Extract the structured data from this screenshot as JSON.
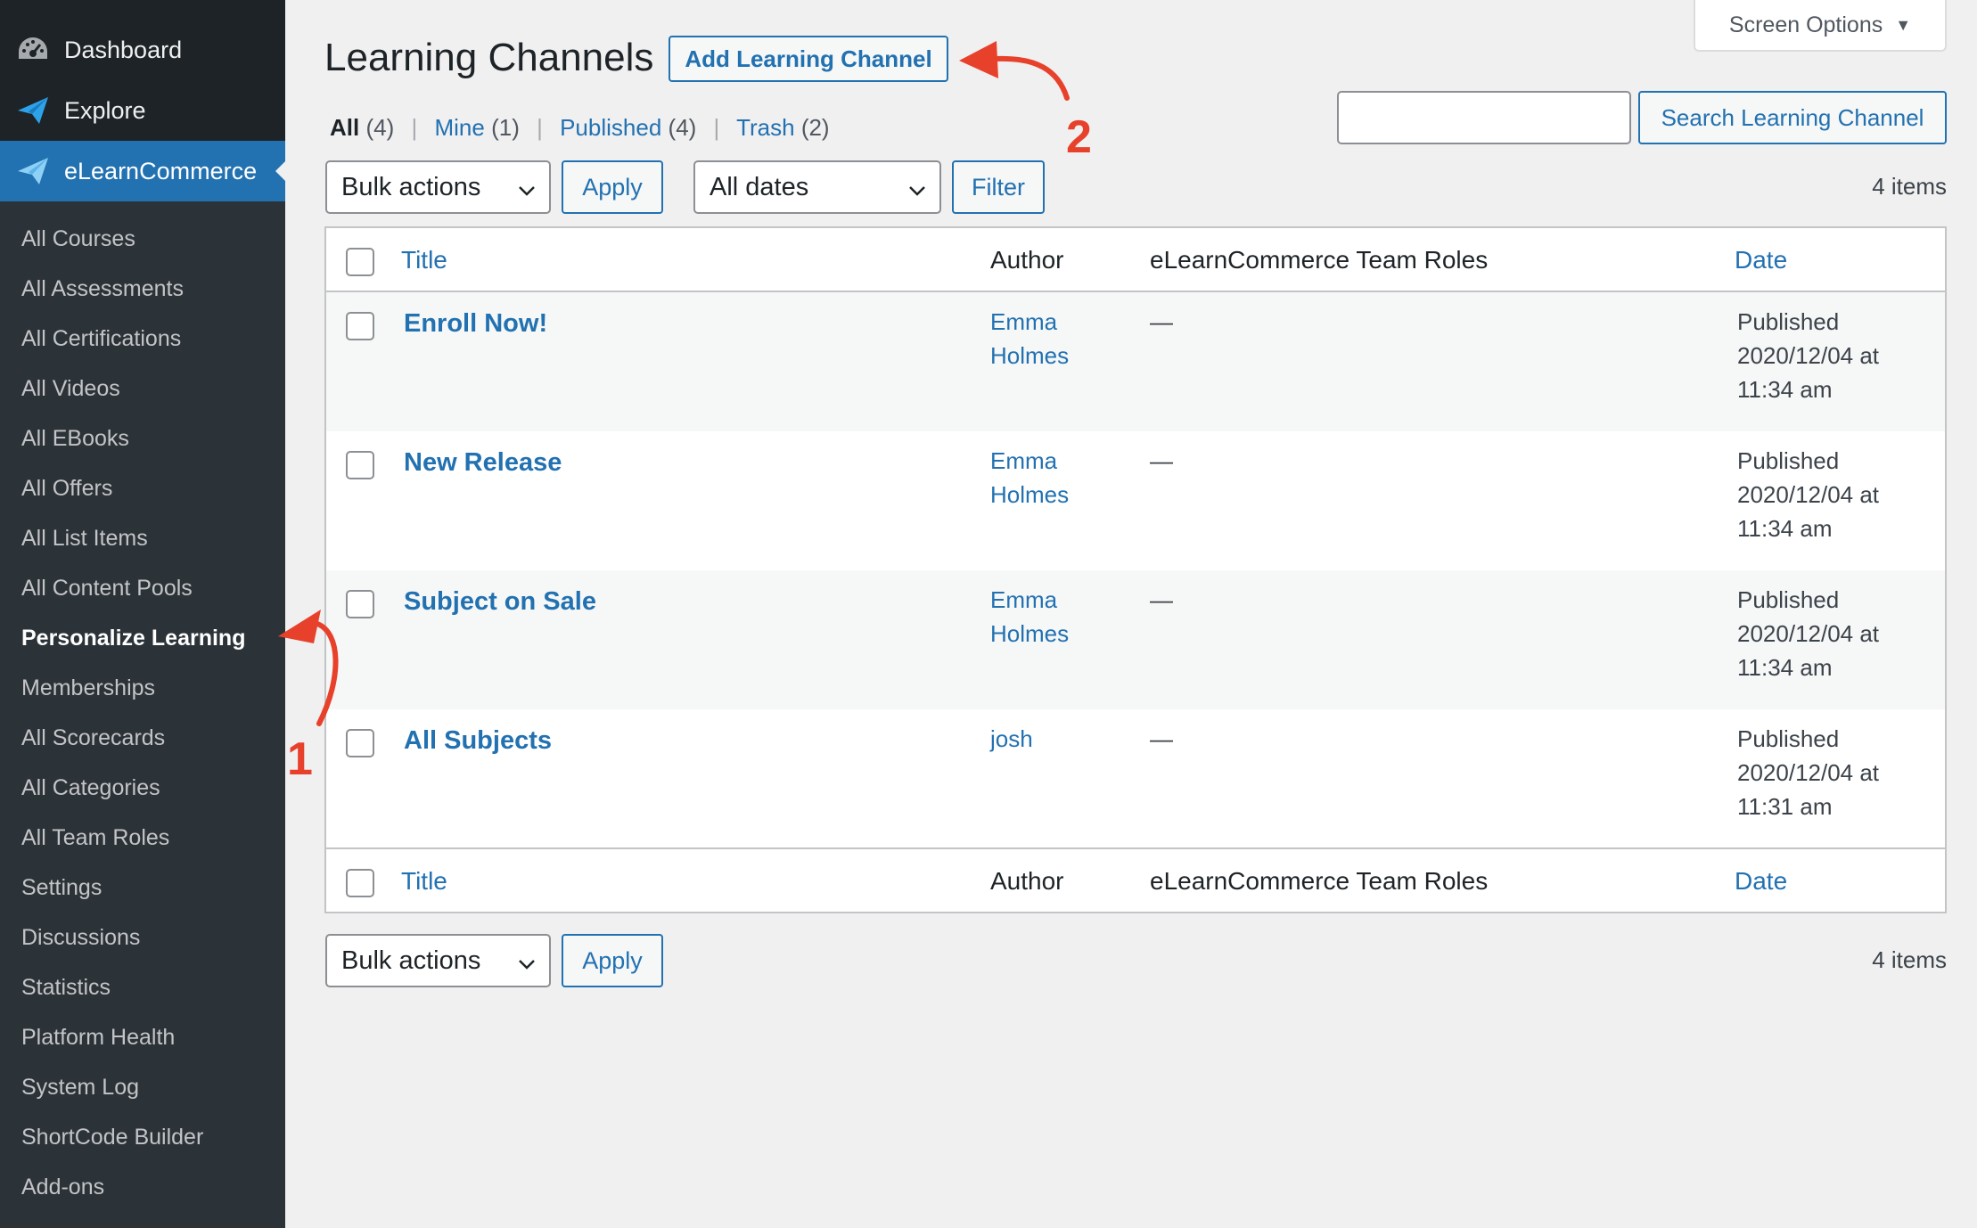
{
  "sidebar": {
    "top_items": [
      {
        "label": "Dashboard",
        "icon": "dashboard-icon"
      },
      {
        "label": "Explore",
        "icon": "paper-plane-icon"
      },
      {
        "label": "eLearnCommerce",
        "icon": "paper-plane-icon",
        "current": true
      }
    ],
    "submenu": [
      "All Courses",
      "All Assessments",
      "All Certifications",
      "All Videos",
      "All EBooks",
      "All Offers",
      "All List Items",
      "All Content Pools",
      "Personalize Learning",
      "Memberships",
      "All Scorecards",
      "All Categories",
      "All Team Roles",
      "Settings",
      "Discussions",
      "Statistics",
      "Platform Health",
      "System Log",
      "ShortCode Builder",
      "Add-ons"
    ],
    "active_submenu": "Personalize Learning"
  },
  "header": {
    "title": "Learning Channels",
    "add_button": "Add Learning Channel",
    "screen_options": "Screen Options"
  },
  "filters": {
    "views": [
      {
        "label": "All",
        "count": "(4)",
        "current": true
      },
      {
        "label": "Mine",
        "count": "(1)"
      },
      {
        "label": "Published",
        "count": "(4)"
      },
      {
        "label": "Trash",
        "count": "(2)"
      }
    ],
    "separator": "|",
    "search_button": "Search Learning Channel",
    "search_value": "",
    "bulk_actions": "Bulk actions",
    "apply": "Apply",
    "dates": "All dates",
    "filter": "Filter",
    "items_count": "4 items"
  },
  "table": {
    "columns": {
      "title": "Title",
      "author": "Author",
      "roles": "eLearnCommerce Team Roles",
      "date": "Date"
    },
    "rows": [
      {
        "title": "Enroll Now!",
        "author_line1": "Emma",
        "author_line2": "Holmes",
        "roles": "—",
        "status": "Published",
        "date": "2020/12/04 at",
        "time": "11:34 am"
      },
      {
        "title": "New Release",
        "author_line1": "Emma",
        "author_line2": "Holmes",
        "roles": "—",
        "status": "Published",
        "date": "2020/12/04 at",
        "time": "11:34 am"
      },
      {
        "title": "Subject on Sale",
        "author_line1": "Emma",
        "author_line2": "Holmes",
        "roles": "—",
        "status": "Published",
        "date": "2020/12/04 at",
        "time": "11:34 am"
      },
      {
        "title": "All Subjects",
        "author_line1": "josh",
        "author_line2": "",
        "roles": "—",
        "status": "Published",
        "date": "2020/12/04 at",
        "time": "11:31 am"
      }
    ]
  },
  "annotations": {
    "marker_1": "1",
    "marker_2": "2",
    "color": "#e8412b"
  },
  "colors": {
    "sidebar_bg": "#1d2327",
    "submenu_bg": "#2c3338",
    "accent": "#2271b1",
    "page_bg": "#f0f0f1"
  }
}
